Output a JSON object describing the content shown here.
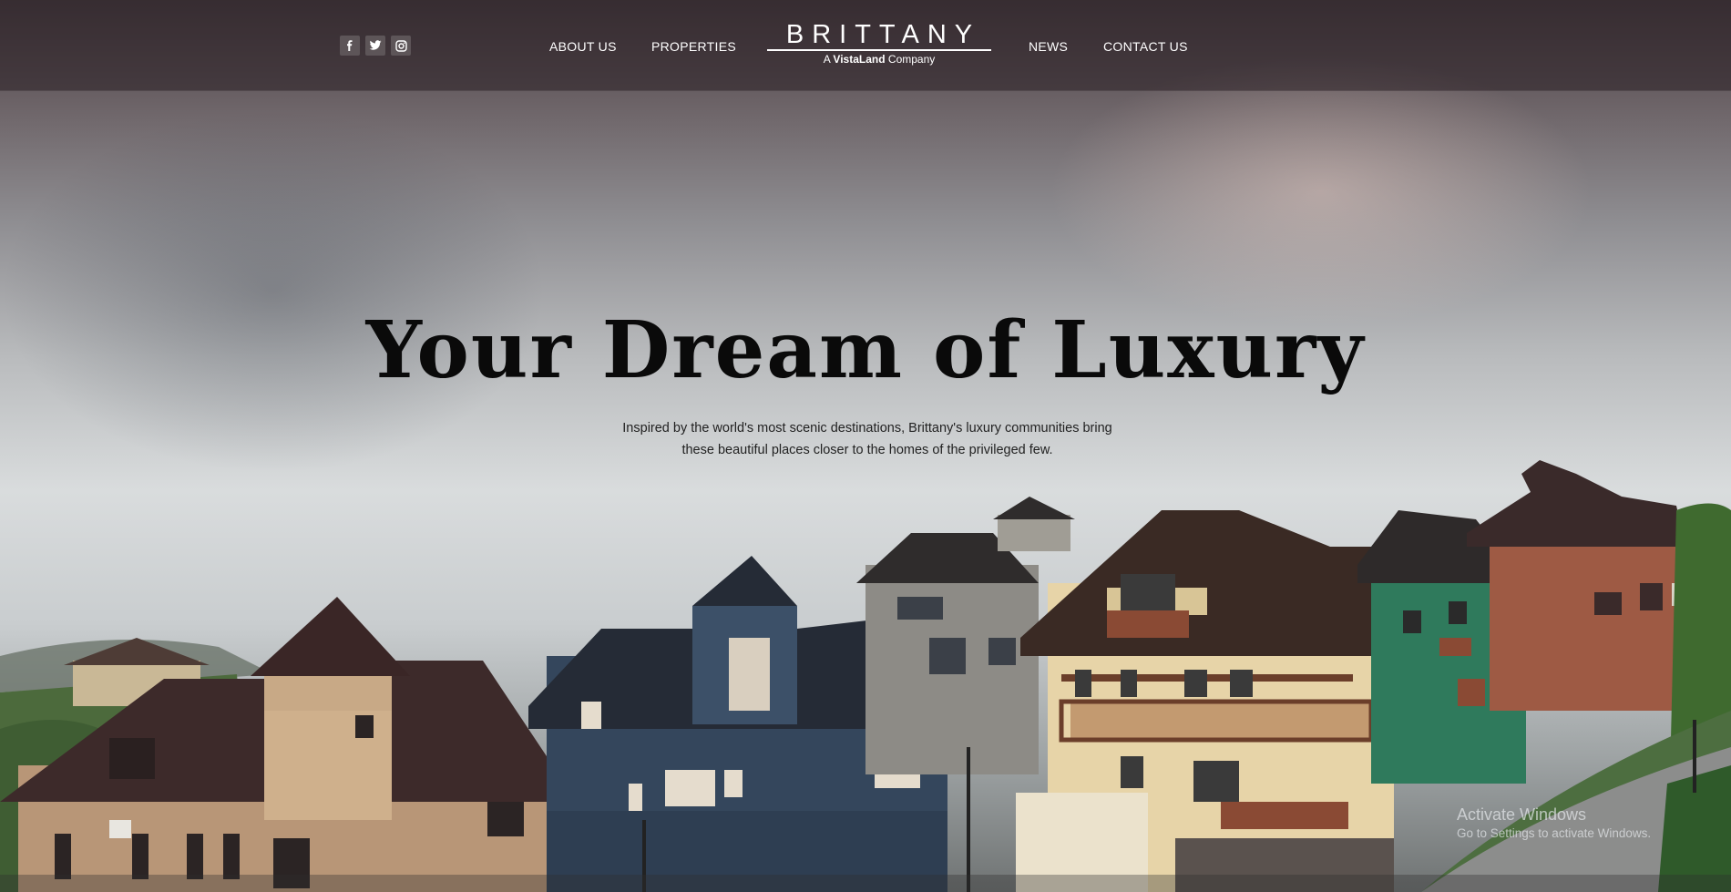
{
  "social": {
    "icons": [
      "facebook-icon",
      "twitter-icon",
      "instagram-icon"
    ]
  },
  "nav": {
    "about_us": "ABOUT US",
    "properties": "PROPERTIES",
    "news": "NEWS",
    "contact_us": "CONTACT US"
  },
  "brand": {
    "wordmark": "BRITTANY",
    "tag_prefix": "A",
    "tag_brand": "VistaLand",
    "tag_suffix": "Company"
  },
  "hero": {
    "headline": "Your Dream of Luxury",
    "subtext_line1": "Inspired by the world's most scenic destinations, Brittany's luxury communities bring",
    "subtext_line2": "these beautiful places closer to the homes of the privileged few."
  },
  "watermark": {
    "title": "Activate Windows",
    "subtitle": "Go to Settings to activate Windows."
  },
  "colors": {
    "nav_bg": "#3a2e32",
    "headline": "#0a0a0a",
    "nav_text": "#ffffff"
  }
}
